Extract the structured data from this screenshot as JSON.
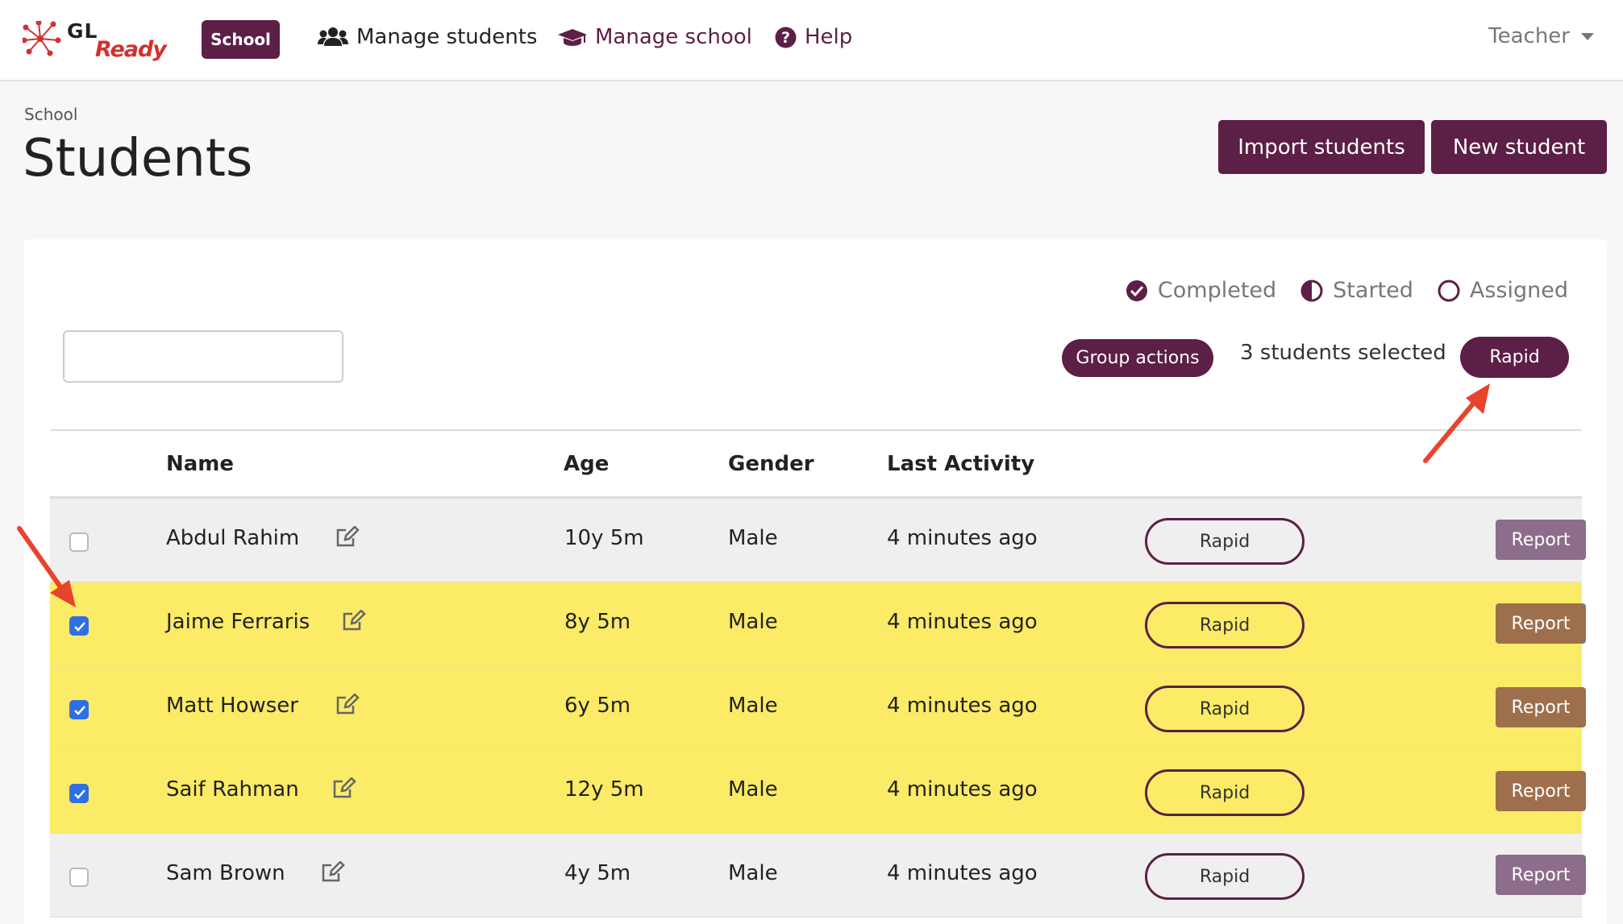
{
  "nav": {
    "logo_gl": "GL",
    "logo_ready": "Ready",
    "school_badge": "School",
    "links": [
      {
        "label": "Manage students",
        "icon": "users-icon"
      },
      {
        "label": "Manage school",
        "icon": "graduation-cap-icon"
      },
      {
        "label": "Help",
        "icon": "question-circle-icon"
      }
    ],
    "user_menu": "Teacher"
  },
  "header": {
    "breadcrumb": "School",
    "title": "Students",
    "import_label": "Import students",
    "new_label": "New student"
  },
  "legend": {
    "completed": "Completed",
    "started": "Started",
    "assigned": "Assigned"
  },
  "toolbar": {
    "search_value": "",
    "group_actions_label": "Group actions",
    "selected_text": "3 students selected",
    "rapid_label": "Rapid"
  },
  "table": {
    "columns": [
      "Name",
      "Age",
      "Gender",
      "Last Activity"
    ],
    "rows": [
      {
        "name": "Abdul Rahim",
        "age": "10y 5m",
        "gender": "Male",
        "last_activity": "4 minutes ago",
        "selected": false,
        "action": "Rapid",
        "report": "Report"
      },
      {
        "name": "Jaime Ferraris",
        "age": "8y 5m",
        "gender": "Male",
        "last_activity": "4 minutes ago",
        "selected": true,
        "action": "Rapid",
        "report": "Report"
      },
      {
        "name": "Matt Howser",
        "age": "6y 5m",
        "gender": "Male",
        "last_activity": "4 minutes ago",
        "selected": true,
        "action": "Rapid",
        "report": "Report"
      },
      {
        "name": "Saif Rahman",
        "age": "12y 5m",
        "gender": "Male",
        "last_activity": "4 minutes ago",
        "selected": true,
        "action": "Rapid",
        "report": "Report"
      },
      {
        "name": "Sam Brown",
        "age": "4y 5m",
        "gender": "Male",
        "last_activity": "4 minutes ago",
        "selected": false,
        "action": "Rapid",
        "report": "Report"
      }
    ]
  },
  "colors": {
    "brand": "#5c1f45",
    "selected_row": "#fbeb67",
    "checkbox_checked": "#2f6fe4",
    "annotation_arrow": "#e8432d"
  }
}
